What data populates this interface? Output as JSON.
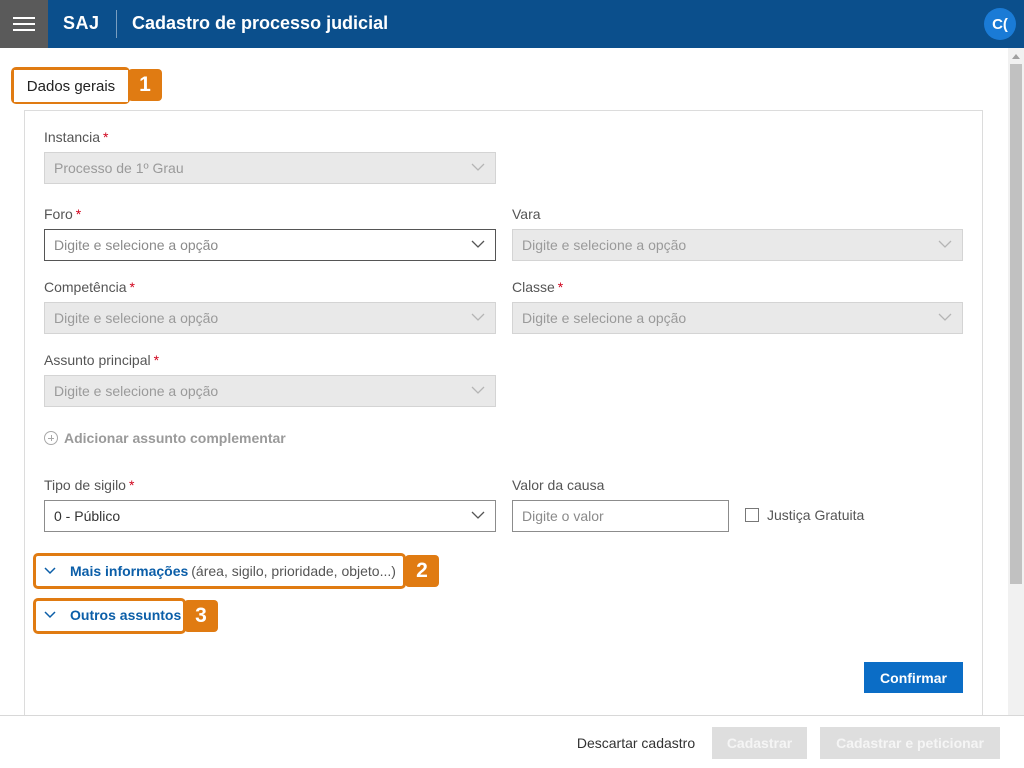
{
  "header": {
    "brand": "SAJ",
    "title": "Cadastro de processo judicial",
    "avatar_initials": "C(",
    "menu_icon": "hamburger-icon",
    "background_color": "#0b4f8c"
  },
  "section_tab": {
    "label": "Dados gerais",
    "callout": "1"
  },
  "form": {
    "instancia": {
      "label": "Instancia",
      "required": "*",
      "value": "Processo de 1º Grau"
    },
    "foro": {
      "label": "Foro",
      "required": "*",
      "placeholder": "Digite e selecione a opção"
    },
    "vara": {
      "label": "Vara",
      "placeholder": "Digite e selecione a opção"
    },
    "competencia": {
      "label": "Competência",
      "required": "*",
      "placeholder": "Digite e selecione a opção"
    },
    "classe": {
      "label": "Classe",
      "required": "*",
      "placeholder": "Digite e selecione a opção"
    },
    "assunto_principal": {
      "label": "Assunto principal",
      "required": "*",
      "placeholder": "Digite e selecione a opção"
    },
    "add_assunto": {
      "label": "Adicionar assunto complementar",
      "icon": "plus-circle-icon"
    },
    "tipo_sigilo": {
      "label": "Tipo de sigilo",
      "required": "*",
      "value": "0 - Público"
    },
    "valor_causa": {
      "label": "Valor da causa",
      "placeholder": "Digite o valor"
    },
    "justica_gratuita": {
      "label": "Justiça Gratuita",
      "checked": false
    }
  },
  "expanders": {
    "mais_informacoes": {
      "link": "Mais informações",
      "hint": "(área, sigilo, prioridade, objeto...)",
      "callout": "2"
    },
    "outros_assuntos": {
      "link": "Outros assuntos",
      "callout": "3"
    }
  },
  "actions": {
    "confirm": "Confirmar",
    "discard": "Descartar cadastro",
    "register": "Cadastrar",
    "register_petition": "Cadastrar e peticionar"
  },
  "colors": {
    "header": "#0b4f8c",
    "primary_button": "#0b6dc6",
    "link": "#0b5ea8",
    "callout": "#e07b12",
    "required": "#d0021b"
  }
}
